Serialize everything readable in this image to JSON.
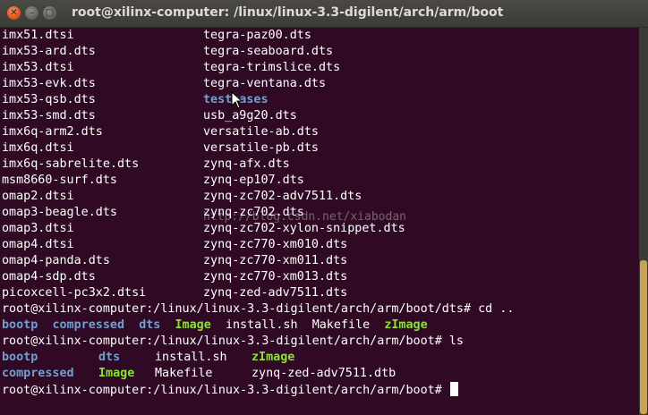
{
  "window": {
    "title": "root@xilinx-computer: /linux/linux-3.3-digilent/arch/arm/boot",
    "close_glyph": "✕",
    "minimize_glyph": "–",
    "maximize_glyph": "□"
  },
  "listing": [
    [
      "imx51.dtsi",
      "tegra-paz00.dts"
    ],
    [
      "imx53-ard.dts",
      "tegra-seaboard.dts"
    ],
    [
      "imx53.dtsi",
      "tegra-trimslice.dts"
    ],
    [
      "imx53-evk.dts",
      "tegra-ventana.dts"
    ],
    [
      "imx53-qsb.dts",
      "testcases"
    ],
    [
      "imx53-smd.dts",
      "usb_a9g20.dts"
    ],
    [
      "imx6q-arm2.dts",
      "versatile-ab.dts"
    ],
    [
      "imx6q.dtsi",
      "versatile-pb.dts"
    ],
    [
      "imx6q-sabrelite.dts",
      "zynq-afx.dts"
    ],
    [
      "msm8660-surf.dts",
      "zynq-ep107.dts"
    ],
    [
      "omap2.dtsi",
      "zynq-zc702-adv7511.dts"
    ],
    [
      "omap3-beagle.dts",
      "zynq-zc702.dts"
    ],
    [
      "omap3.dtsi",
      "zynq-zc702-xylon-snippet.dts"
    ],
    [
      "omap4.dtsi",
      "zynq-zc770-xm010.dts"
    ],
    [
      "omap4-panda.dts",
      "zynq-zc770-xm011.dts"
    ],
    [
      "omap4-sdp.dts",
      "zynq-zc770-xm013.dts"
    ],
    [
      "picoxcell-pc3x2.dtsi",
      "zynq-zed-adv7511.dts"
    ]
  ],
  "prompt1": "root@xilinx-computer:/linux/linux-3.3-digilent/arch/arm/boot/dts# cd ..",
  "ls1": {
    "bootp": "bootp",
    "compressed": "compressed",
    "dts": "dts",
    "image": "Image",
    "install": "install.sh",
    "makefile": "Makefile",
    "zimage": "zImage"
  },
  "prompt2": "root@xilinx-computer:/linux/linux-3.3-digilent/arch/arm/boot# ls",
  "ls2_row1": {
    "bootp": "bootp",
    "dts": "dts",
    "install": "install.sh",
    "zimage": "zImage"
  },
  "ls2_row2": {
    "compressed": "compressed",
    "image": "Image",
    "makefile": "Makefile",
    "dtb": "zynq-zed-adv7511.dtb"
  },
  "prompt3": "root@xilinx-computer:/linux/linux-3.3-digilent/arch/arm/boot# ",
  "watermark": "http://blog.csdn.net/xiabodan",
  "colors": {
    "background": "#300a24",
    "directory": "#729fcf",
    "executable": "#8ae234",
    "text": "#ffffff"
  },
  "icons": [
    "close-icon",
    "minimize-icon",
    "maximize-icon",
    "mouse-pointer-icon"
  ]
}
